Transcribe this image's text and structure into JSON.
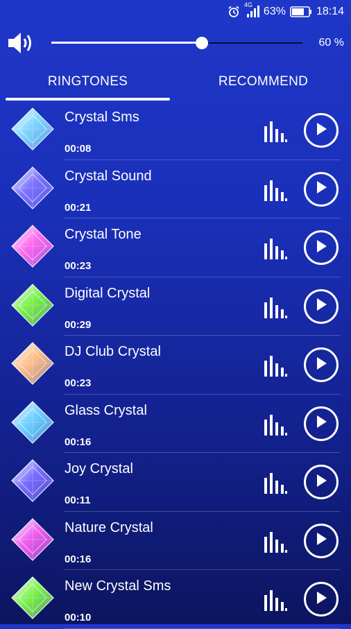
{
  "status_bar": {
    "network": "4G",
    "battery": "63%",
    "time": "18:14",
    "icons": [
      "alarm-icon",
      "signal-icon",
      "battery-icon"
    ]
  },
  "volume": {
    "icon": "speaker-icon",
    "level": 0.6,
    "label": "60 %"
  },
  "tabs": [
    {
      "label": "RINGTONES",
      "selected": true
    },
    {
      "label": "RECOMMEND",
      "selected": false
    }
  ],
  "ringtones": [
    {
      "title": "Crystal Sms",
      "duration": "00:08",
      "gem_color": "#7fd8ff"
    },
    {
      "title": "Crystal Sound",
      "duration": "00:21",
      "gem_color": "#7c73ff"
    },
    {
      "title": "Crystal Tone",
      "duration": "00:23",
      "gem_color": "#ff6bf0"
    },
    {
      "title": "Digital Crystal",
      "duration": "00:29",
      "gem_color": "#7cf24a"
    },
    {
      "title": "DJ Club Crystal",
      "duration": "00:23",
      "gem_color": "#ffc08a"
    },
    {
      "title": "Glass Crystal",
      "duration": "00:16",
      "gem_color": "#6fd1ff"
    },
    {
      "title": "Joy Crystal",
      "duration": "00:11",
      "gem_color": "#7a6cff"
    },
    {
      "title": "Nature Crystal",
      "duration": "00:16",
      "gem_color": "#f15ef0"
    },
    {
      "title": "New Crystal Sms",
      "duration": "00:10",
      "gem_color": "#7ef34e"
    }
  ],
  "row_icons": {
    "equalizer": "equalizer-icon",
    "play": "play-icon"
  }
}
